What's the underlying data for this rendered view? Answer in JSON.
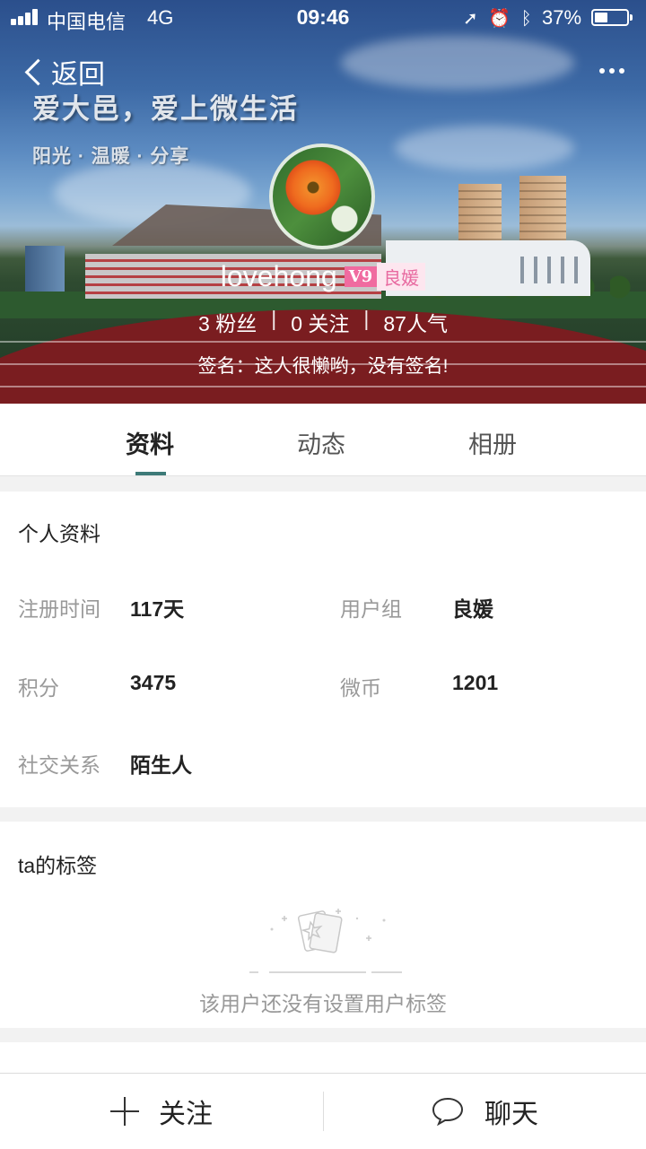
{
  "status_bar": {
    "carrier": "中国电信",
    "network": "4G",
    "time": "09:46",
    "battery": "37%",
    "icons": [
      "signal-icon",
      "location-icon",
      "alarm-icon",
      "bluetooth-icon",
      "battery-icon"
    ]
  },
  "nav": {
    "back_label": "返回",
    "more_icon": "more-dots-icon"
  },
  "banner": {
    "line1": "爱大邑，爱上微生活",
    "line2": "阳光 · 温暖 · 分享"
  },
  "profile": {
    "username": "lovehong",
    "vip_level": "V9",
    "rank": "良媛",
    "stats": [
      "3 粉丝",
      "0 关注",
      "87人气"
    ],
    "stat_separator": "|",
    "signature": "签名：这人很懒哟，没有签名!"
  },
  "tabs": [
    {
      "label": "资料",
      "active": true
    },
    {
      "label": "动态",
      "active": false
    },
    {
      "label": "相册",
      "active": false
    }
  ],
  "personal_info": {
    "title": "个人资料",
    "fields": [
      {
        "label": "注册时间",
        "value": "117天"
      },
      {
        "label": "用户组",
        "value": "良媛"
      },
      {
        "label": "积分",
        "value": "3475"
      },
      {
        "label": "微币",
        "value": "1201"
      },
      {
        "label": "社交关系",
        "value": "陌生人"
      }
    ]
  },
  "tags": {
    "title": "ta的标签",
    "empty_text": "该用户还没有设置用户标签"
  },
  "bottom_bar": {
    "follow_label": "关注",
    "chat_label": "聊天"
  },
  "colors": {
    "accent": "#3d7a78",
    "vip": "#f06ba0",
    "rank_bg": "#fde6ef"
  }
}
